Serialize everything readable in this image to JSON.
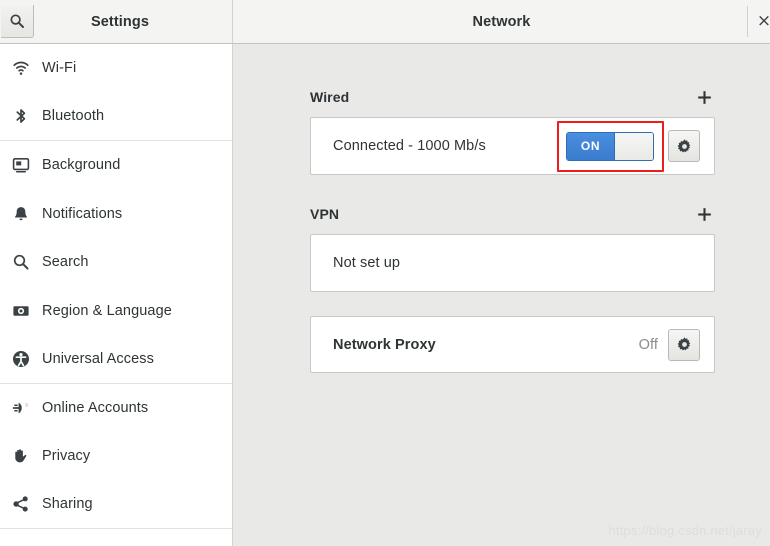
{
  "window": {
    "sidebar_title": "Settings",
    "content_title": "Network",
    "close_label": "×",
    "search_icon": "search-icon"
  },
  "sidebar": {
    "items": [
      {
        "label": "Wi-Fi",
        "icon": "wifi-icon",
        "separator_after": false
      },
      {
        "label": "Bluetooth",
        "icon": "bluetooth-icon",
        "separator_after": true
      },
      {
        "label": "Background",
        "icon": "background-icon",
        "separator_after": false
      },
      {
        "label": "Notifications",
        "icon": "bell-icon",
        "separator_after": false
      },
      {
        "label": "Search",
        "icon": "search-icon",
        "separator_after": false
      },
      {
        "label": "Region & Language",
        "icon": "region-language-icon",
        "separator_after": false
      },
      {
        "label": "Universal Access",
        "icon": "accessibility-icon",
        "separator_after": true
      },
      {
        "label": "Online Accounts",
        "icon": "online-accounts-icon",
        "separator_after": false
      },
      {
        "label": "Privacy",
        "icon": "hand-icon",
        "separator_after": false
      },
      {
        "label": "Sharing",
        "icon": "share-icon",
        "separator_after": true
      }
    ]
  },
  "main": {
    "wired": {
      "title": "Wired",
      "add_label": "+",
      "status": "Connected - 1000 Mb/s",
      "toggle_state": "ON",
      "toggle_on": true,
      "settings_icon": "gear-icon",
      "highlighted": true
    },
    "vpn": {
      "title": "VPN",
      "add_label": "+",
      "status": "Not set up"
    },
    "proxy": {
      "label": "Network Proxy",
      "value": "Off",
      "settings_icon": "gear-icon"
    }
  },
  "watermark": "https://blog.csdn.net/jaray",
  "colors": {
    "accent": "#3a7ccd",
    "annotation": "#ee1d1d",
    "panel_bg": "#e9e9e7",
    "card_bg": "#ffffff",
    "text": "#2e3436",
    "muted_text": "#8a8a86"
  }
}
